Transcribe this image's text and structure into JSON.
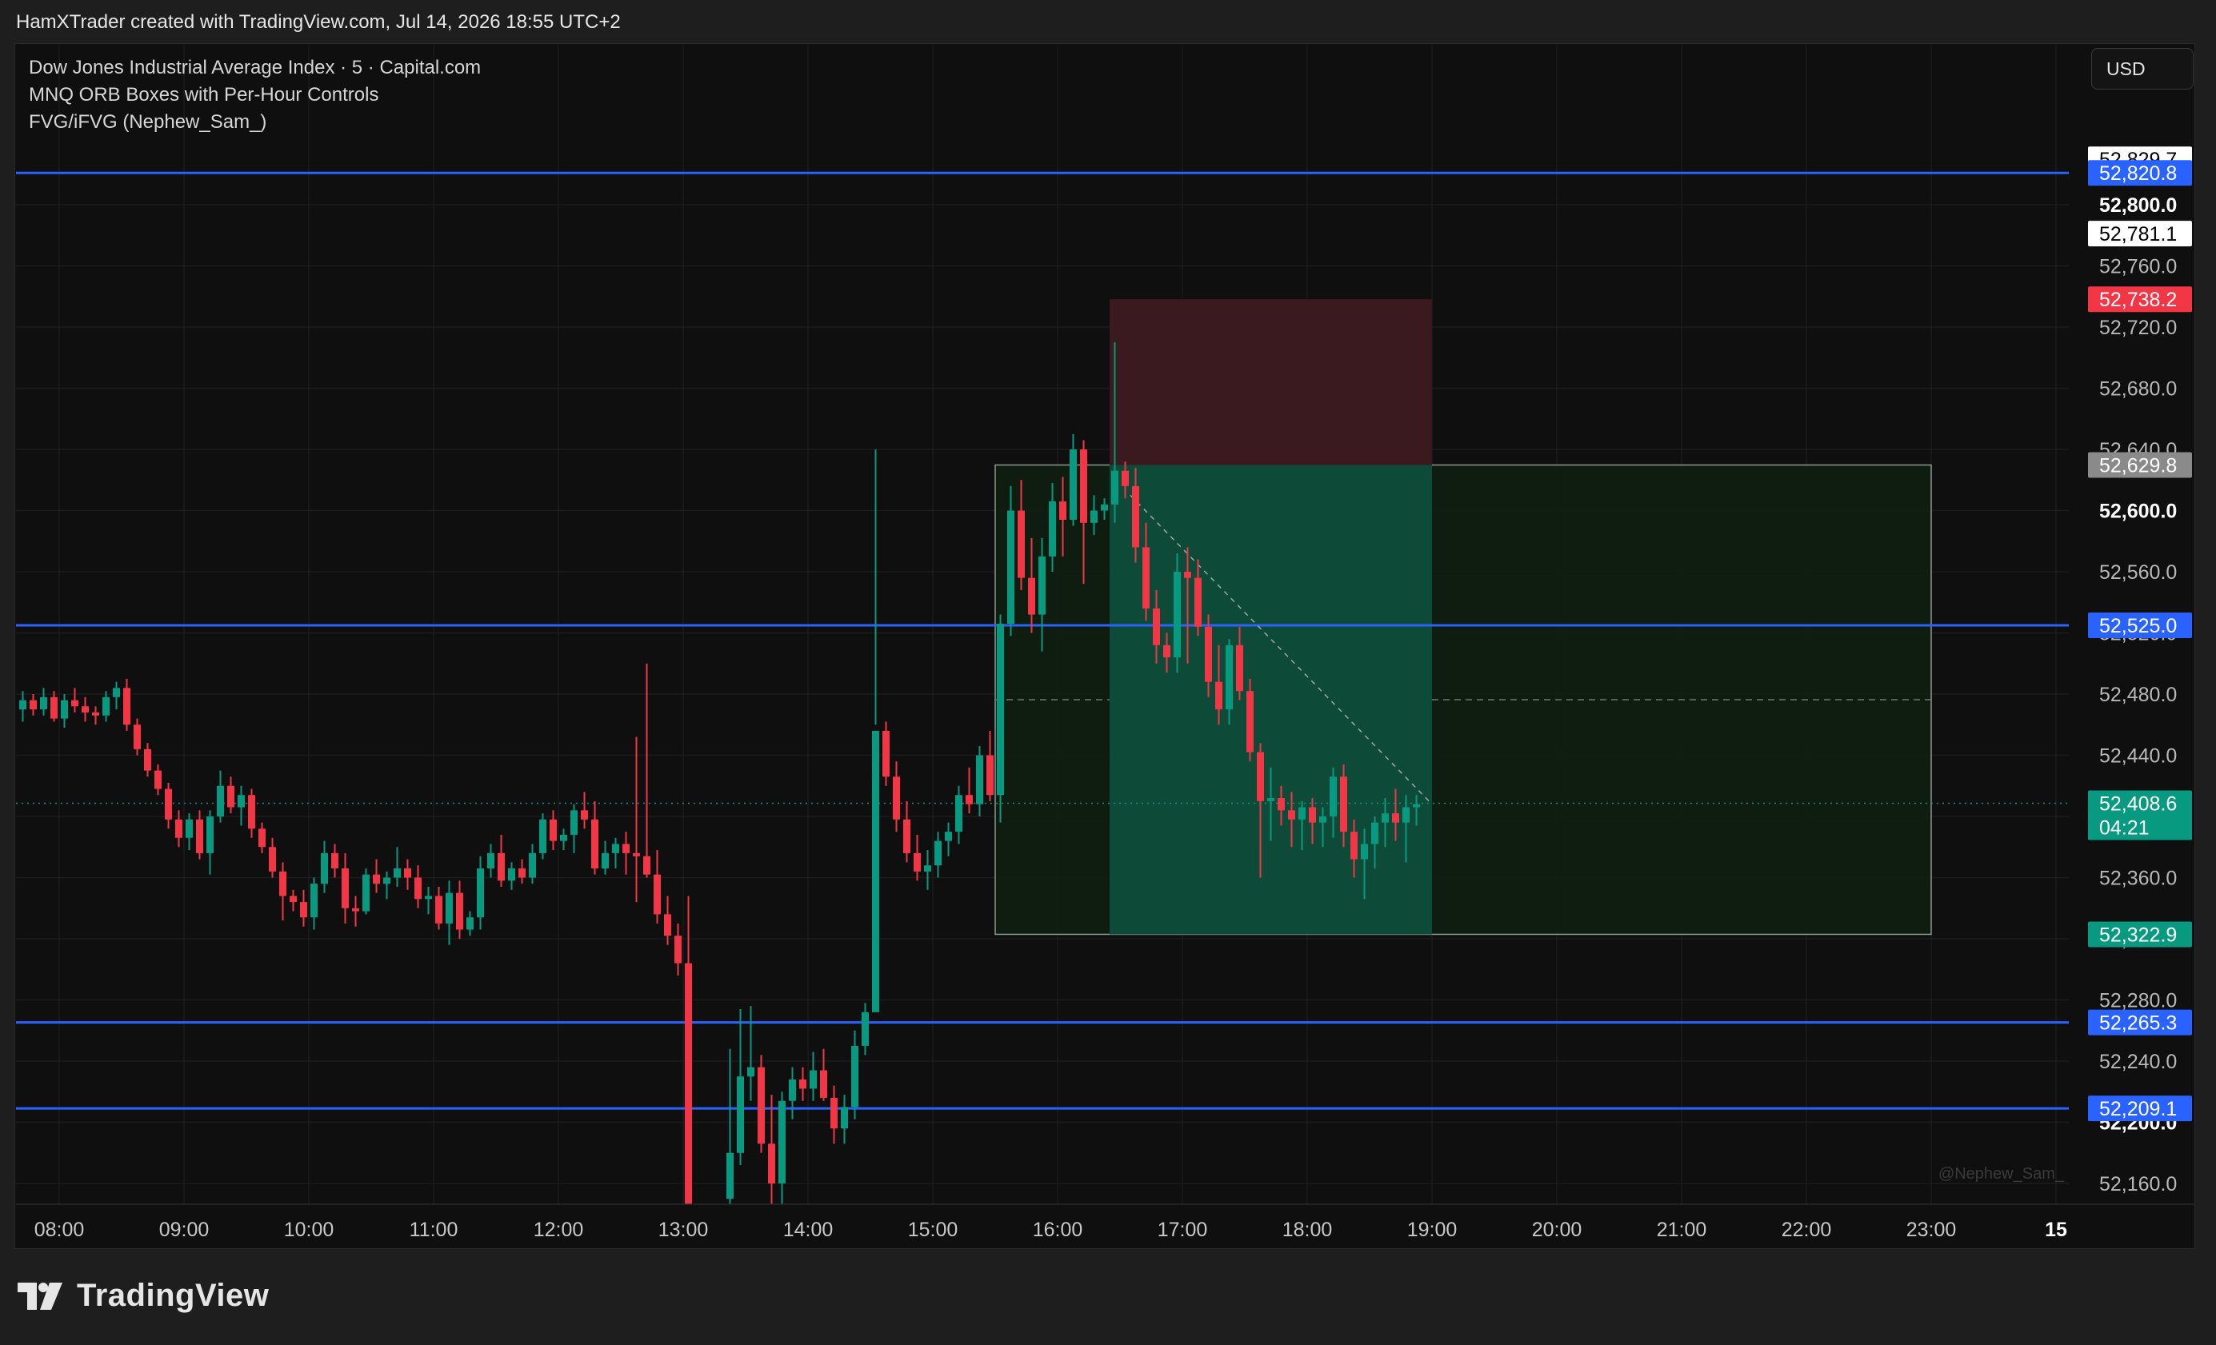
{
  "header": {
    "credit": "HamXTrader created with TradingView.com, Jul 14, 2026 18:55 UTC+2"
  },
  "legend": {
    "symbol": "Dow Jones Industrial Average Index · 5 · Capital.com",
    "indicator_1": "MNQ ORB Boxes with Per-Hour Controls",
    "indicator_2": "FVG/iFVG (Nephew_Sam_)"
  },
  "currency": "USD",
  "footer": {
    "brand": "TradingView"
  },
  "watermark": "@Nephew_Sam_",
  "colors": {
    "up": "#089981",
    "down": "#f23645",
    "level_line": "#2962ff",
    "target_zone": "#0e4a38",
    "stop_zone": "#3a1a1e",
    "orb_box_fill": "#0f1f12",
    "orb_box_border": "#8a9a8e"
  },
  "chart_data": {
    "type": "candlestick",
    "timeframe": "5",
    "x_axis": {
      "type": "time",
      "ticks": [
        "08:00",
        "09:00",
        "10:00",
        "11:00",
        "12:00",
        "13:00",
        "14:00",
        "15:00",
        "16:00",
        "17:00",
        "18:00",
        "19:00",
        "20:00",
        "21:00",
        "22:00",
        "23:00",
        "15"
      ]
    },
    "y_axis": {
      "ylim": [
        52140,
        52860
      ],
      "ticks": [
        "52,160.0",
        "52,200.0",
        "52,240.0",
        "52,280.0",
        "52,320.0",
        "52,360.0",
        "52,400.0",
        "52,440.0",
        "52,480.0",
        "52,520.0",
        "52,560.0",
        "52,600.0",
        "52,640.0",
        "52,680.0",
        "52,720.0",
        "52,760.0",
        "52,800.0"
      ]
    },
    "price_labels": [
      {
        "value": 52829.7,
        "text": "52,829.7",
        "style": "white"
      },
      {
        "value": 52820.8,
        "text": "52,820.8",
        "style": "blue"
      },
      {
        "value": 52781.1,
        "text": "52,781.1",
        "style": "white"
      },
      {
        "value": 52738.2,
        "text": "52,738.2",
        "style": "red"
      },
      {
        "value": 52629.8,
        "text": "52,629.8",
        "style": "gray"
      },
      {
        "value": 52525.0,
        "text": "52,525.0",
        "style": "blue"
      },
      {
        "value": 52408.6,
        "text": "52,408.6",
        "style": "green",
        "countdown": "04:21"
      },
      {
        "value": 52322.9,
        "text": "52,322.9",
        "style": "green"
      },
      {
        "value": 52265.3,
        "text": "52,265.3",
        "style": "blue"
      },
      {
        "value": 52209.1,
        "text": "52,209.1",
        "style": "blue"
      }
    ],
    "horizontal_levels": [
      52820.8,
      52525.0,
      52265.3,
      52209.1
    ],
    "last_price": 52408.6,
    "orb_box": {
      "start": "15:30",
      "end": "23:00",
      "high": 52629.8,
      "low": 52322.9,
      "mid": 52476.35
    },
    "position": {
      "type": "short",
      "start": "16:25",
      "end": "19:00",
      "entry": 52629.8,
      "stop": 52738.2,
      "target": 52322.9
    },
    "trend_line": {
      "start_time": "16:35",
      "start_price": 52610,
      "end_time": "19:00",
      "end_price": 52408
    },
    "candles": [
      [
        "07:35",
        52474,
        52478,
        52464,
        52470
      ],
      [
        "07:40",
        52470,
        52482,
        52462,
        52476
      ],
      [
        "07:45",
        52476,
        52480,
        52466,
        52470
      ],
      [
        "07:50",
        52470,
        52484,
        52466,
        52478
      ],
      [
        "07:55",
        52478,
        52482,
        52462,
        52464
      ],
      [
        "08:00",
        52464,
        52480,
        52458,
        52476
      ],
      [
        "08:05",
        52476,
        52484,
        52468,
        52472
      ],
      [
        "08:10",
        52472,
        52478,
        52462,
        52468
      ],
      [
        "08:15",
        52468,
        52472,
        52460,
        52466
      ],
      [
        "08:20",
        52466,
        52482,
        52462,
        52478
      ],
      [
        "08:25",
        52478,
        52488,
        52470,
        52484
      ],
      [
        "08:30",
        52484,
        52490,
        52456,
        52460
      ],
      [
        "08:35",
        52460,
        52464,
        52440,
        52444
      ],
      [
        "08:40",
        52444,
        52448,
        52426,
        52430
      ],
      [
        "08:45",
        52430,
        52434,
        52414,
        52418
      ],
      [
        "08:50",
        52418,
        52422,
        52392,
        52398
      ],
      [
        "08:55",
        52398,
        52404,
        52380,
        52386
      ],
      [
        "09:00",
        52386,
        52402,
        52378,
        52398
      ],
      [
        "09:05",
        52398,
        52404,
        52372,
        52376
      ],
      [
        "09:10",
        52376,
        52404,
        52362,
        52400
      ],
      [
        "09:15",
        52400,
        52430,
        52396,
        52420
      ],
      [
        "09:20",
        52420,
        52426,
        52402,
        52406
      ],
      [
        "09:25",
        52406,
        52420,
        52394,
        52414
      ],
      [
        "09:30",
        52414,
        52418,
        52386,
        52392
      ],
      [
        "09:35",
        52392,
        52396,
        52376,
        52380
      ],
      [
        "09:40",
        52380,
        52386,
        52360,
        52364
      ],
      [
        "09:45",
        52364,
        52370,
        52332,
        52348
      ],
      [
        "09:50",
        52348,
        52352,
        52338,
        52344
      ],
      [
        "09:55",
        52344,
        52352,
        52328,
        52334
      ],
      [
        "10:00",
        52334,
        52360,
        52326,
        52356
      ],
      [
        "10:05",
        52356,
        52384,
        52350,
        52376
      ],
      [
        "10:10",
        52376,
        52382,
        52360,
        52366
      ],
      [
        "10:15",
        52366,
        52376,
        52330,
        52340
      ],
      [
        "10:20",
        52340,
        52348,
        52328,
        52338
      ],
      [
        "10:25",
        52338,
        52366,
        52336,
        52362
      ],
      [
        "10:30",
        52362,
        52372,
        52350,
        52356
      ],
      [
        "10:35",
        52356,
        52364,
        52346,
        52360
      ],
      [
        "10:40",
        52360,
        52380,
        52354,
        52366
      ],
      [
        "10:45",
        52366,
        52372,
        52352,
        52360
      ],
      [
        "10:50",
        52360,
        52368,
        52340,
        52346
      ],
      [
        "10:55",
        52346,
        52354,
        52336,
        52348
      ],
      [
        "11:00",
        52348,
        52354,
        52326,
        52330
      ],
      [
        "11:05",
        52330,
        52358,
        52316,
        52350
      ],
      [
        "11:10",
        52350,
        52358,
        52320,
        52326
      ],
      [
        "11:15",
        52326,
        52338,
        52322,
        52334
      ],
      [
        "11:20",
        52334,
        52374,
        52326,
        52366
      ],
      [
        "11:25",
        52366,
        52382,
        52360,
        52376
      ],
      [
        "11:30",
        52376,
        52388,
        52354,
        52358
      ],
      [
        "11:35",
        52358,
        52370,
        52352,
        52366
      ],
      [
        "11:40",
        52366,
        52372,
        52356,
        52360
      ],
      [
        "11:45",
        52360,
        52382,
        52356,
        52376
      ],
      [
        "11:50",
        52376,
        52402,
        52372,
        52398
      ],
      [
        "11:55",
        52398,
        52404,
        52378,
        52384
      ],
      [
        "12:00",
        52384,
        52392,
        52378,
        52388
      ],
      [
        "12:05",
        52388,
        52408,
        52376,
        52404
      ],
      [
        "12:10",
        52404,
        52416,
        52392,
        52398
      ],
      [
        "12:15",
        52398,
        52410,
        52362,
        52366
      ],
      [
        "12:20",
        52366,
        52384,
        52362,
        52376
      ],
      [
        "12:25",
        52376,
        52386,
        52366,
        52382
      ],
      [
        "12:30",
        52382,
        52390,
        52362,
        52376
      ],
      [
        "12:35",
        52376,
        52452,
        52344,
        52374
      ],
      [
        "12:40",
        52374,
        52500,
        52360,
        52362
      ],
      [
        "12:45",
        52362,
        52378,
        52330,
        52336
      ],
      [
        "12:50",
        52336,
        52348,
        52316,
        52322
      ],
      [
        "12:55",
        52322,
        52330,
        52296,
        52304
      ],
      [
        "13:00",
        52304,
        52348,
        52140,
        52140
      ],
      [
        "13:20",
        52150,
        52248,
        52140,
        52180
      ],
      [
        "13:25",
        52180,
        52274,
        52172,
        52230
      ],
      [
        "13:30",
        52230,
        52276,
        52214,
        52236
      ],
      [
        "13:35",
        52236,
        52244,
        52180,
        52186
      ],
      [
        "13:40",
        52186,
        52218,
        52140,
        52160
      ],
      [
        "13:45",
        52160,
        52220,
        52146,
        52214
      ],
      [
        "13:50",
        52214,
        52236,
        52202,
        52228
      ],
      [
        "13:55",
        52228,
        52236,
        52214,
        52222
      ],
      [
        "14:00",
        52222,
        52246,
        52214,
        52234
      ],
      [
        "14:05",
        52234,
        52248,
        52214,
        52216
      ],
      [
        "14:10",
        52216,
        52224,
        52186,
        52196
      ],
      [
        "14:15",
        52196,
        52218,
        52186,
        52210
      ],
      [
        "14:20",
        52210,
        52260,
        52202,
        52250
      ],
      [
        "14:25",
        52250,
        52278,
        52244,
        52272
      ],
      [
        "14:30",
        52272,
        52640,
        52460,
        52456
      ],
      [
        "14:35",
        52456,
        52462,
        52420,
        52426
      ],
      [
        "14:40",
        52426,
        52436,
        52390,
        52398
      ],
      [
        "14:45",
        52398,
        52410,
        52370,
        52376
      ],
      [
        "14:50",
        52376,
        52388,
        52358,
        52364
      ],
      [
        "14:55",
        52364,
        52378,
        52352,
        52368
      ],
      [
        "15:00",
        52368,
        52390,
        52360,
        52384
      ],
      [
        "15:05",
        52384,
        52396,
        52374,
        52390
      ],
      [
        "15:10",
        52390,
        52420,
        52382,
        52414
      ],
      [
        "15:15",
        52414,
        52432,
        52402,
        52408
      ],
      [
        "15:20",
        52408,
        52446,
        52400,
        52440
      ],
      [
        "15:25",
        52440,
        52456,
        52410,
        52414
      ],
      [
        "15:30",
        52414,
        52532,
        52396,
        52526
      ],
      [
        "15:35",
        52526,
        52616,
        52518,
        52600
      ],
      [
        "15:40",
        52600,
        52620,
        52548,
        52556
      ],
      [
        "15:45",
        52556,
        52582,
        52520,
        52532
      ],
      [
        "15:50",
        52532,
        52582,
        52508,
        52570
      ],
      [
        "15:55",
        52570,
        52618,
        52560,
        52606
      ],
      [
        "16:00",
        52606,
        52622,
        52570,
        52594
      ],
      [
        "16:05",
        52594,
        52650,
        52590,
        52640
      ],
      [
        "16:10",
        52640,
        52646,
        52552,
        52592
      ],
      [
        "16:15",
        52592,
        52610,
        52584,
        52600
      ],
      [
        "16:20",
        52600,
        52608,
        52594,
        52604
      ],
      [
        "16:25",
        52604,
        52710,
        52592,
        52626
      ],
      [
        "16:30",
        52626,
        52632,
        52608,
        52616
      ],
      [
        "16:35",
        52616,
        52628,
        52566,
        52576
      ],
      [
        "16:40",
        52576,
        52592,
        52528,
        52536
      ],
      [
        "16:45",
        52536,
        52548,
        52500,
        52512
      ],
      [
        "16:50",
        52512,
        52520,
        52494,
        52504
      ],
      [
        "16:55",
        52504,
        52572,
        52494,
        52560
      ],
      [
        "17:00",
        52560,
        52576,
        52500,
        52556
      ],
      [
        "17:05",
        52556,
        52568,
        52518,
        52524
      ],
      [
        "17:10",
        52524,
        52532,
        52478,
        52488
      ],
      [
        "17:15",
        52488,
        52512,
        52460,
        52470
      ],
      [
        "17:20",
        52470,
        52516,
        52460,
        52512
      ],
      [
        "17:25",
        52512,
        52524,
        52476,
        52482
      ],
      [
        "17:30",
        52482,
        52490,
        52436,
        52442
      ],
      [
        "17:35",
        52442,
        52448,
        52360,
        52410
      ],
      [
        "17:40",
        52410,
        52432,
        52384,
        52412
      ],
      [
        "17:45",
        52412,
        52420,
        52394,
        52404
      ],
      [
        "17:50",
        52404,
        52416,
        52380,
        52398
      ],
      [
        "17:55",
        52398,
        52410,
        52378,
        52406
      ],
      [
        "18:00",
        52406,
        52412,
        52382,
        52396
      ],
      [
        "18:05",
        52396,
        52406,
        52380,
        52400
      ],
      [
        "18:10",
        52400,
        52432,
        52386,
        52426
      ],
      [
        "18:15",
        52426,
        52434,
        52380,
        52390
      ],
      [
        "18:20",
        52390,
        52398,
        52360,
        52372
      ],
      [
        "18:25",
        52372,
        52392,
        52346,
        52382
      ],
      [
        "18:30",
        52382,
        52400,
        52366,
        52396
      ],
      [
        "18:35",
        52396,
        52412,
        52380,
        52402
      ],
      [
        "18:40",
        52402,
        52418,
        52384,
        52396
      ],
      [
        "18:45",
        52396,
        52414,
        52370,
        52406
      ],
      [
        "18:50",
        52406,
        52414,
        52394,
        52408
      ]
    ]
  }
}
